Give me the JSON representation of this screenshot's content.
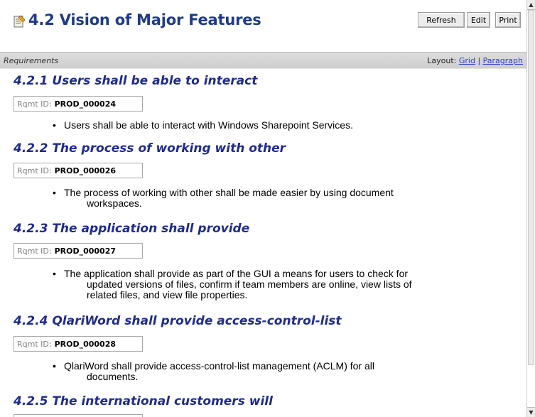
{
  "header": {
    "title": "4.2 Vision of Major Features",
    "icon": "document-edit-icon",
    "buttons": {
      "refresh": "Refresh",
      "edit": "Edit",
      "print": "Print"
    }
  },
  "section_bar": {
    "label": "Requirements",
    "layout_label": "Layout:",
    "grid_link": "Grid",
    "separator": "|",
    "paragraph_link": "Paragraph"
  },
  "requirements": [
    {
      "heading": "4.2.1 Users shall be able to interact",
      "id_label": "Rqmt ID:",
      "id": "PROD_000024",
      "lines": [
        "Users shall be able to interact with Windows Sharepoint Services."
      ]
    },
    {
      "heading": "4.2.2 The process of working with other",
      "id_label": "Rqmt ID:",
      "id": "PROD_000026",
      "lines": [
        "The process of working with other shall be made easier by using document",
        "workspaces."
      ]
    },
    {
      "heading": "4.2.3 The application shall provide",
      "id_label": "Rqmt ID:",
      "id": "PROD_000027",
      "lines": [
        "The application shall provide as part of the GUI a means for users to check for",
        "updated versions of files, confirm if team members are online, view lists of",
        "related files, and view file properties."
      ]
    },
    {
      "heading": "4.2.4 QlariWord shall provide access-control-list",
      "id_label": "Rqmt ID:",
      "id": "PROD_000028",
      "lines": [
        "QlariWord shall provide access-control-list management (ACLM) for all",
        "documents."
      ]
    },
    {
      "heading": "4.2.5 The international customers will",
      "id_label": "",
      "id": "",
      "lines": []
    }
  ]
}
